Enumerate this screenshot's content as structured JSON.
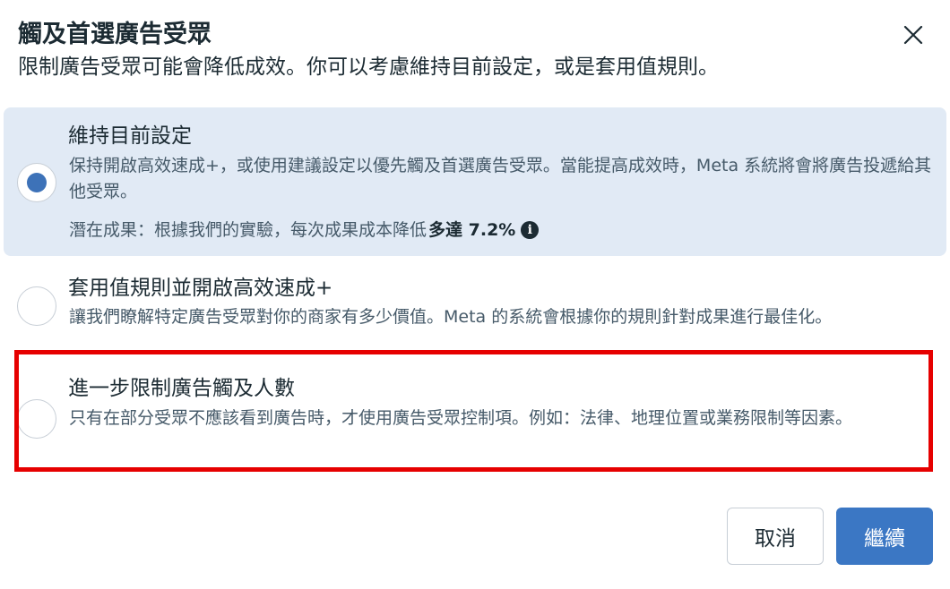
{
  "dialog": {
    "title": "觸及首選廣告受眾",
    "subtitle": "限制廣告受眾可能會降低成效。你可以考慮維持目前設定，或是套用值規則。",
    "close_icon": "close-icon"
  },
  "options": [
    {
      "title": "維持目前設定",
      "description": "保持開啟高效速成+，或使用建議設定以優先觸及首選廣告受眾。當能提高成效時，Meta 系統將會將廣告投遞給其他受眾。",
      "result_prefix": "潛在成果：根據我們的實驗，每次成果成本降低",
      "result_value": "多達 7.2%",
      "info_icon": "info-icon",
      "selected": true
    },
    {
      "title": "套用值規則並開啟高效速成+",
      "description": "讓我們瞭解特定廣告受眾對你的商家有多少價值。Meta 的系統會根據你的規則針對成果進行最佳化。",
      "selected": false
    },
    {
      "title": "進一步限制廣告觸及人數",
      "description": "只有在部分受眾不應該看到廣告時，才使用廣告受眾控制項。例如：法律、地理位置或業務限制等因素。",
      "selected": false
    }
  ],
  "buttons": {
    "cancel": "取消",
    "continue": "繼續"
  },
  "colors": {
    "selected_bg": "#e1eaf5",
    "radio_selected": "#3d72b8",
    "primary_button": "#3b77c4",
    "highlight_border": "#e60000"
  }
}
